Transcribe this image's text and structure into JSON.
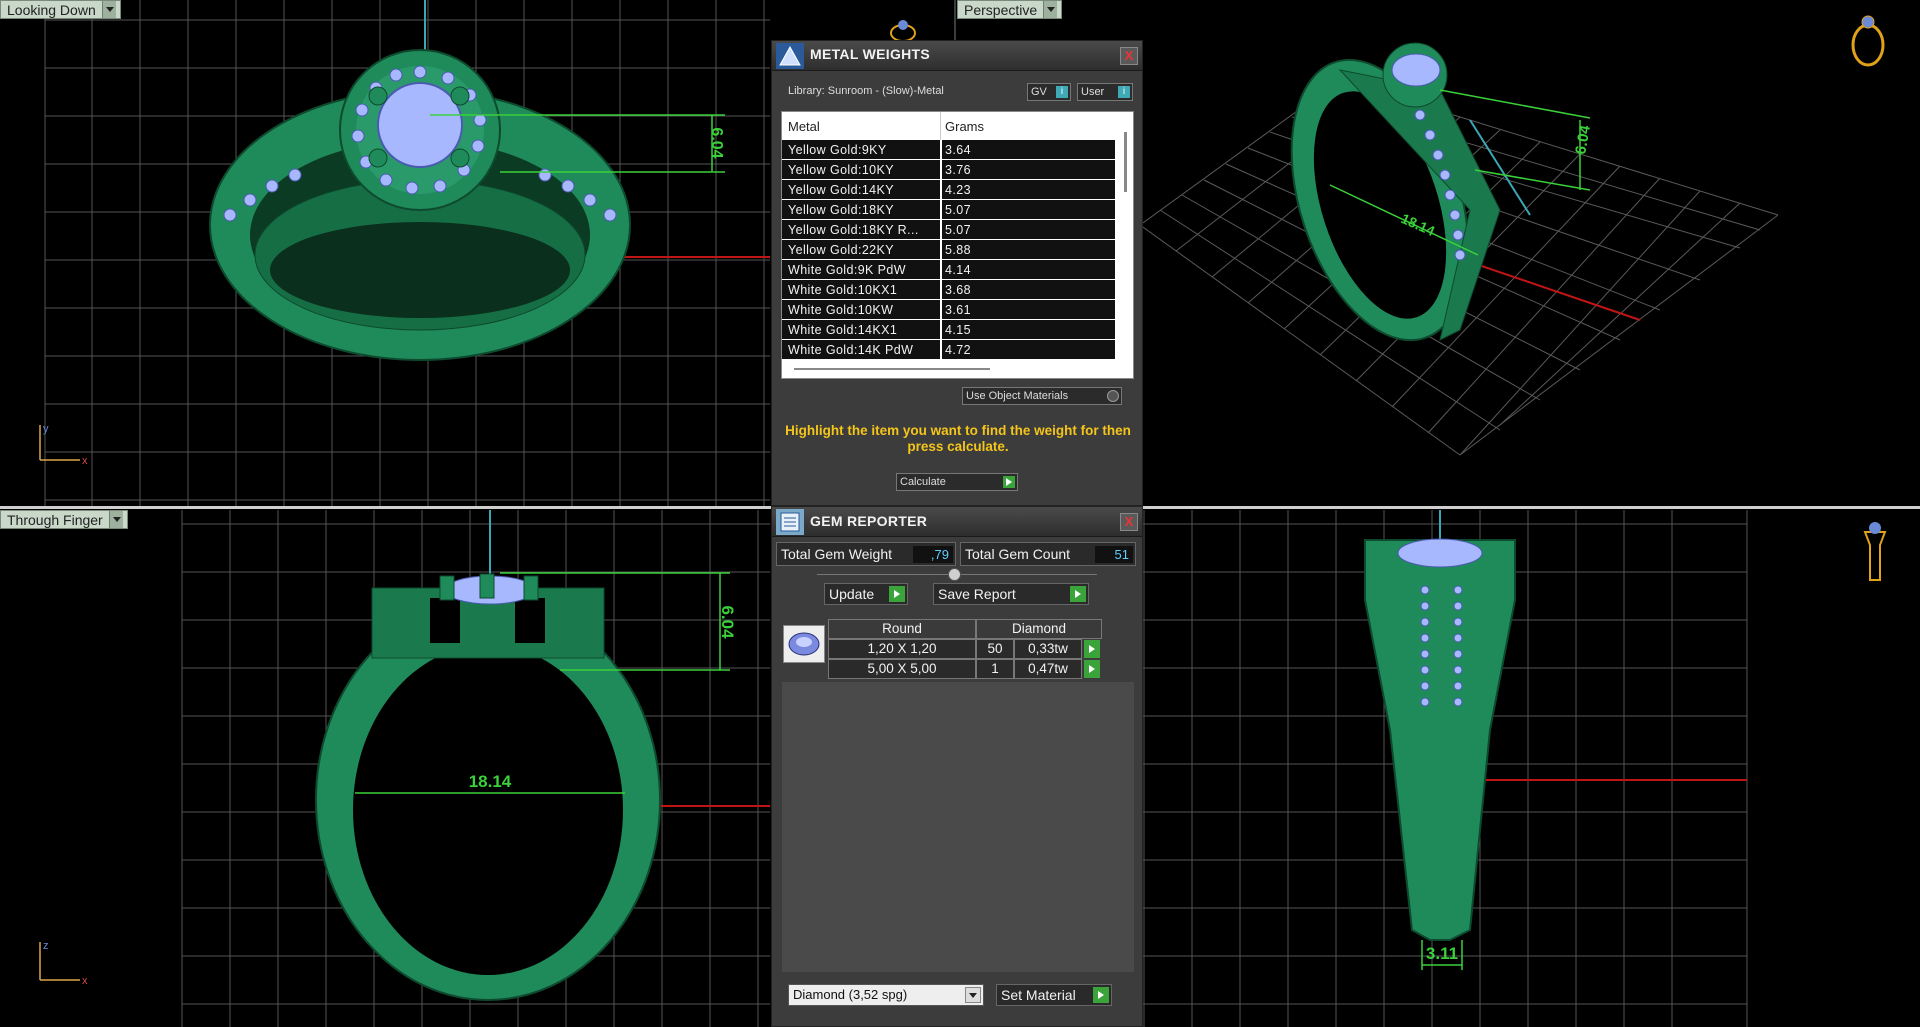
{
  "viewports": {
    "top_left": {
      "label": "Looking Down",
      "dim_vertical": "6.04",
      "axis_y": "y",
      "axis_x": "x"
    },
    "top_right": {
      "label": "Perspective",
      "dim_vertical": "6.04",
      "dim_diameter": "18.14"
    },
    "bottom_left": {
      "label": "Through Finger",
      "dim_vertical": "6.04",
      "dim_diameter": "18.14",
      "axis_z": "z",
      "axis_x": "x"
    },
    "bottom_right": {
      "dim_bottom": "3.11"
    }
  },
  "metal_weights": {
    "title": "METAL WEIGHTS",
    "close": "X",
    "library": "Library: Sunroom - (Slow)-Metal",
    "gv_label": "GV",
    "user_label": "User",
    "info_glyph": "i",
    "columns": [
      "Metal",
      "Grams"
    ],
    "rows": [
      {
        "metal": "Yellow Gold:9KY",
        "grams": "3.64"
      },
      {
        "metal": "Yellow Gold:10KY",
        "grams": "3.76"
      },
      {
        "metal": "Yellow Gold:14KY",
        "grams": "4.23"
      },
      {
        "metal": "Yellow Gold:18KY",
        "grams": "5.07"
      },
      {
        "metal": "Yellow Gold:18KY R...",
        "grams": "5.07"
      },
      {
        "metal": "Yellow Gold:22KY",
        "grams": "5.88"
      },
      {
        "metal": "White Gold:9K PdW",
        "grams": "4.14"
      },
      {
        "metal": "White Gold:10KX1",
        "grams": "3.68"
      },
      {
        "metal": "White Gold:10KW",
        "grams": "3.61"
      },
      {
        "metal": "White Gold:14KX1",
        "grams": "4.15"
      },
      {
        "metal": "White Gold:14K PdW",
        "grams": "4.72"
      }
    ],
    "use_object_materials": "Use Object Materials",
    "hint": "Highlight the item you want to find the weight for then press calculate.",
    "calculate": "Calculate"
  },
  "gem_reporter": {
    "title": "GEM REPORTER",
    "close": "X",
    "total_weight_label": "Total Gem Weight",
    "total_weight_value": ",79",
    "total_count_label": "Total Gem Count",
    "total_count_value": "51",
    "update": "Update",
    "save_report": "Save Report",
    "shape": "Round",
    "material": "Diamond",
    "rows": [
      {
        "size": "1,20 X 1,20",
        "count": "50",
        "weight": "0,33tw"
      },
      {
        "size": "5,00 X 5,00",
        "count": "1",
        "weight": "0,47tw"
      }
    ],
    "material_select": "Diamond    (3,52 spg)",
    "set_material": "Set Material"
  },
  "colors": {
    "ring_green": "#1f8a5a",
    "wire_green": "#3ad13a",
    "gem_blue": "#a8b8ff",
    "grid": "#6e6e6e",
    "hint_yellow": "#f4c51a",
    "accent_green": "#3aa33a"
  }
}
